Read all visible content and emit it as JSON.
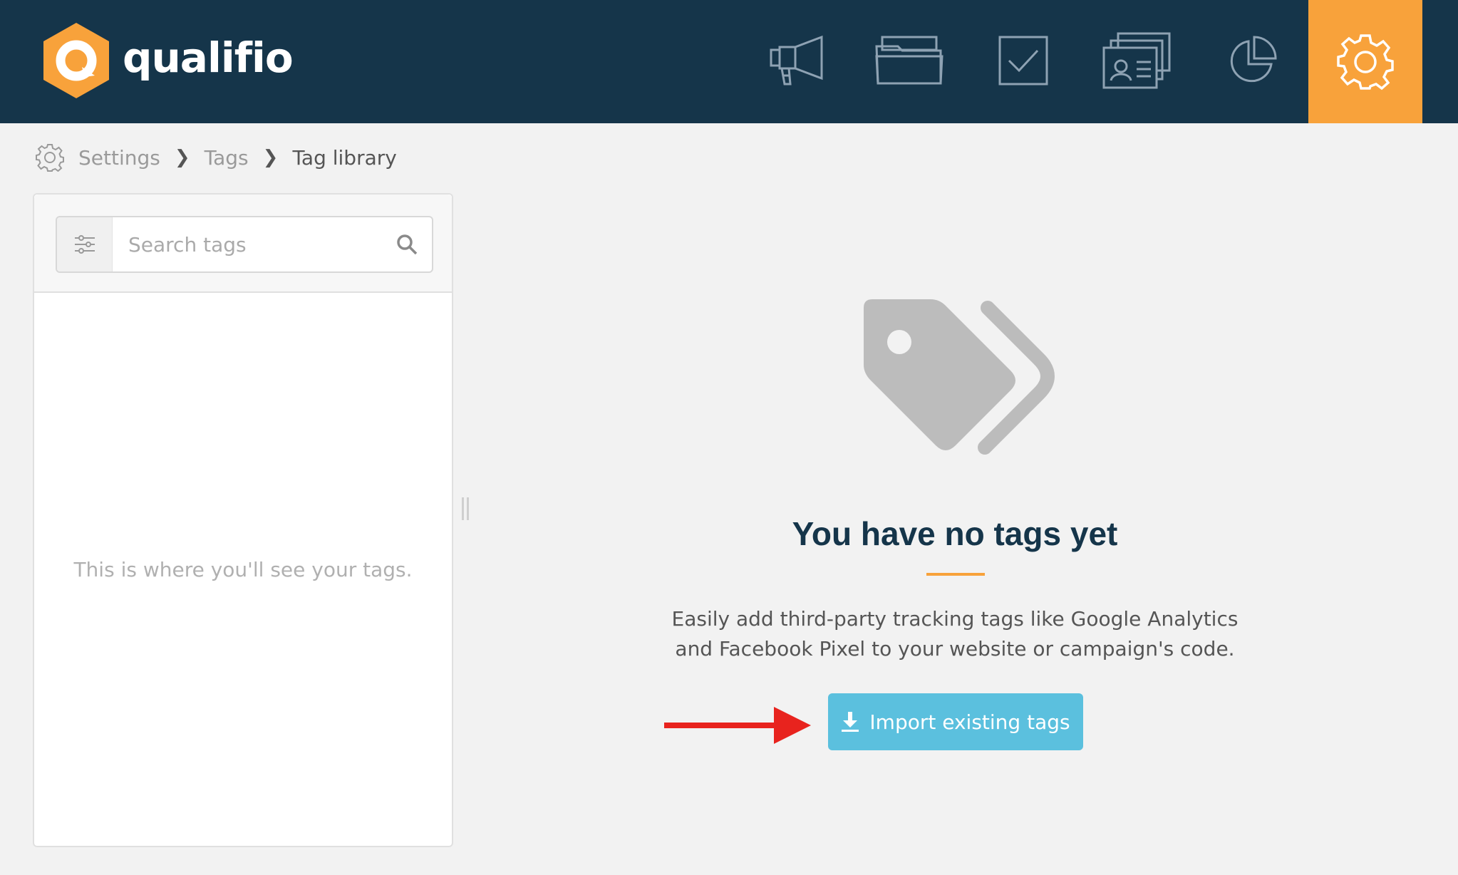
{
  "header": {
    "brand": "qualifio",
    "nav": [
      {
        "icon": "megaphone-icon"
      },
      {
        "icon": "folder-icon"
      },
      {
        "icon": "checkbox-icon"
      },
      {
        "icon": "contacts-icon"
      },
      {
        "icon": "pie-chart-icon"
      },
      {
        "icon": "gear-icon",
        "active": true
      }
    ],
    "colors": {
      "bar": "#15354a",
      "active": "#f8a23b"
    }
  },
  "breadcrumb": {
    "items": [
      "Settings",
      "Tags",
      "Tag library"
    ]
  },
  "sidebar": {
    "search_placeholder": "Search tags",
    "empty_text": "This is where you'll see your tags."
  },
  "main": {
    "title": "You have no tags yet",
    "description": "Easily add third-party tracking tags like Google Analytics and Facebook Pixel to your website or campaign's code.",
    "import_button": "Import existing tags",
    "colors": {
      "button": "#5bc0de",
      "accent": "#f8a23b",
      "arrow": "#e8231e"
    }
  }
}
